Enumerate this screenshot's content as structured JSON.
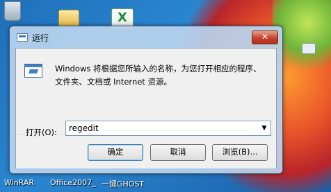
{
  "desktop": {
    "icon_labels": [
      "WinRAR",
      "Office2007_",
      "一键GHOST"
    ]
  },
  "dialog": {
    "title": "运行",
    "close_glyph": "✕",
    "description_line1": "Windows 将根据您所输入的名称，为您打开相应的程序、",
    "description_line2": "文件夹、文档或 Internet 资源。",
    "open_label": "打开(O):",
    "open_value": "regedit",
    "buttons": {
      "ok": "确定",
      "cancel": "取消",
      "browse": "浏览(B)..."
    }
  }
}
